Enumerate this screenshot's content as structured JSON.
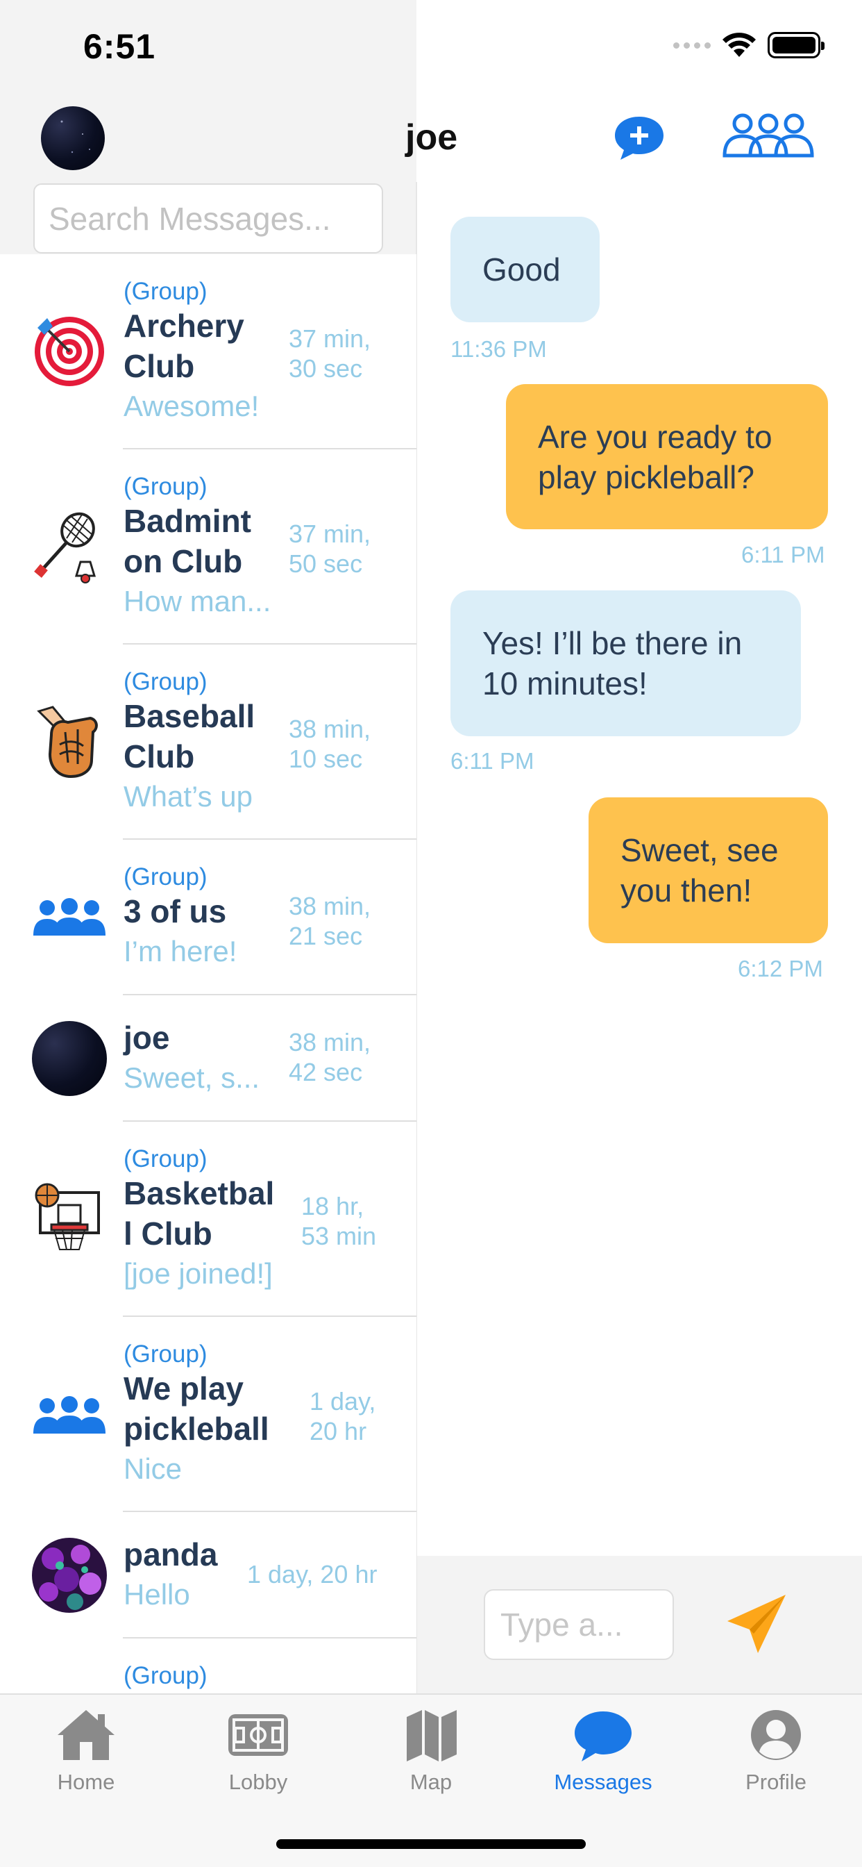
{
  "status_bar": {
    "time": "6:51"
  },
  "header": {
    "chat_title": "joe",
    "avatar_icon": "galaxy-avatar",
    "compose_icon": "message-plus-icon",
    "groups_icon": "people-group-icon"
  },
  "search": {
    "placeholder": "Search Messages..."
  },
  "conversations": [
    {
      "is_group": true,
      "group_tag": "(Group)",
      "name_lines": [
        "Archery",
        "Club"
      ],
      "preview": "Awesome!",
      "time_lines": [
        "37 min,",
        "30 sec"
      ],
      "icon": "archery-target-icon"
    },
    {
      "is_group": true,
      "group_tag": "(Group)",
      "name_lines": [
        "Badmint",
        "on Club"
      ],
      "preview": "How man...",
      "time_lines": [
        "37 min,",
        "50 sec"
      ],
      "icon": "badminton-racket-icon"
    },
    {
      "is_group": true,
      "group_tag": "(Group)",
      "name_lines": [
        "Baseball",
        "Club"
      ],
      "preview": "What’s up",
      "time_lines": [
        "38 min,",
        "10 sec"
      ],
      "icon": "baseball-glove-icon"
    },
    {
      "is_group": true,
      "group_tag": "(Group)",
      "name_lines": [
        "3 of us"
      ],
      "preview": "I’m here!",
      "time_lines": [
        "38 min,",
        "21 sec"
      ],
      "icon": "people-group-icon"
    },
    {
      "is_group": false,
      "group_tag": "",
      "name_lines": [
        "joe"
      ],
      "preview": "Sweet, s...",
      "time_lines": [
        "38 min,",
        "42 sec"
      ],
      "icon": "galaxy-avatar"
    },
    {
      "is_group": true,
      "group_tag": "(Group)",
      "name_lines": [
        "Basketbal",
        "l Club"
      ],
      "preview": "[joe joined!]",
      "time_lines": [
        "18 hr,",
        "53 min"
      ],
      "icon": "basketball-hoop-icon"
    },
    {
      "is_group": true,
      "group_tag": "(Group)",
      "name_lines": [
        "We play",
        "pickleball"
      ],
      "preview": "Nice",
      "time_lines": [
        "1 day,",
        "20 hr"
      ],
      "icon": "people-group-icon"
    },
    {
      "is_group": false,
      "group_tag": "",
      "name_lines": [
        "panda"
      ],
      "preview": "Hello",
      "time_lines": [
        "1 day, 20 hr"
      ],
      "icon": "purple-flowers-avatar"
    },
    {
      "is_group": true,
      "group_tag": "(Group)",
      "name_lines": [],
      "preview": "",
      "time_lines": [],
      "icon": ""
    }
  ],
  "messages": [
    {
      "direction": "received",
      "lines": [
        "Good"
      ],
      "time": "11:36 PM"
    },
    {
      "direction": "sent",
      "lines": [
        "Are you ready to",
        "play pickleball?"
      ],
      "time": "6:11 PM"
    },
    {
      "direction": "received",
      "lines": [
        "Yes! I’ll be there in",
        "10 minutes!"
      ],
      "time": "6:11 PM"
    },
    {
      "direction": "sent",
      "lines": [
        "Sweet, see",
        "you then!"
      ],
      "time": "6:12 PM"
    }
  ],
  "composer": {
    "placeholder": "Type a...",
    "send_icon": "paper-plane-icon"
  },
  "tabs": [
    {
      "label": "Home",
      "icon": "house-icon",
      "active": false
    },
    {
      "label": "Lobby",
      "icon": "field-icon",
      "active": false
    },
    {
      "label": "Map",
      "icon": "map-icon",
      "active": false
    },
    {
      "label": "Messages",
      "icon": "chat-bubble-icon",
      "active": true
    },
    {
      "label": "Profile",
      "icon": "person-circle-icon",
      "active": false
    }
  ],
  "colors": {
    "accent": "#1a78e6",
    "sent_bubble": "#fec24e",
    "received_bubble": "#dbeef8",
    "preview_text": "#93cbe6",
    "send_icon": "#fda619",
    "name_text": "#263a55"
  }
}
